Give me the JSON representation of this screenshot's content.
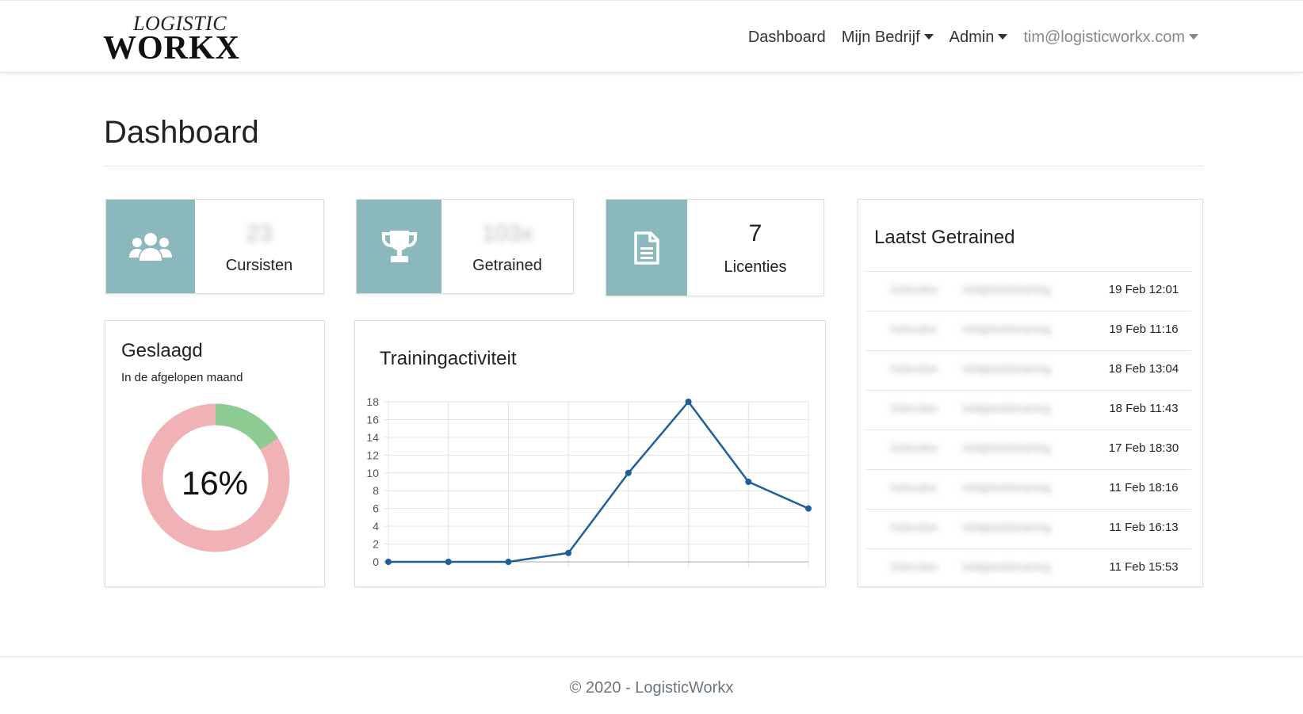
{
  "brand": {
    "logo_top": "LOGISTIC",
    "logo_main": "WORKX",
    "accent": "#e0a81a"
  },
  "nav": {
    "dashboard": "Dashboard",
    "company": "Mijn Bedrijf",
    "admin": "Admin",
    "user": "tim@logisticworkx.com"
  },
  "page": {
    "title": "Dashboard"
  },
  "stats": {
    "accent_color": "#8ab8bd",
    "trainees": {
      "value": "23",
      "label": "Cursisten",
      "icon": "users-icon",
      "obscured": true
    },
    "trained": {
      "value": "103x",
      "label": "Getrained",
      "icon": "trophy-icon",
      "obscured": true
    },
    "licenses": {
      "value": "7",
      "label": "Licenties",
      "icon": "document-icon"
    }
  },
  "passed": {
    "title": "Geslaagd",
    "subtitle": "In de afgelopen maand",
    "percent_label": "16%",
    "fraction": 0.16,
    "colors": {
      "passed": "#8ccc92",
      "failed": "#f1b2b5"
    }
  },
  "activity": {
    "title": "Trainingactiviteit",
    "chart_data": {
      "type": "line",
      "x": [
        1,
        2,
        3,
        4,
        5,
        6,
        7,
        8
      ],
      "values": [
        0,
        0,
        0,
        1,
        10,
        18,
        9,
        6
      ],
      "y_ticks": [
        "0",
        "2",
        "4",
        "6",
        "8",
        "10",
        "12",
        "14",
        "16",
        "18"
      ],
      "ylim": [
        0,
        18
      ],
      "grid": true,
      "line_color": "#1f5f99"
    }
  },
  "recent": {
    "title": "Laatst Getrained",
    "rows": [
      {
        "name": "Gebruiker",
        "course": "Veiligheidstraining",
        "date": "19 Feb 12:01"
      },
      {
        "name": "Gebruiker",
        "course": "Veiligheidstraining",
        "date": "19 Feb 11:16"
      },
      {
        "name": "Gebruiker",
        "course": "Veiligheidstraining",
        "date": "18 Feb 13:04"
      },
      {
        "name": "Gebruiker",
        "course": "Veiligheidstraining",
        "date": "18 Feb 11:43"
      },
      {
        "name": "Gebruiker",
        "course": "Veiligheidstraining",
        "date": "17 Feb 18:30"
      },
      {
        "name": "Gebruiker",
        "course": "Veiligheidstraining",
        "date": "11 Feb 18:16"
      },
      {
        "name": "Gebruiker",
        "course": "Veiligheidstraining",
        "date": "11 Feb 16:13"
      },
      {
        "name": "Gebruiker",
        "course": "Veiligheidstraining",
        "date": "11 Feb 15:53"
      }
    ]
  },
  "footer": {
    "text": "© 2020 - LogisticWorkx"
  }
}
